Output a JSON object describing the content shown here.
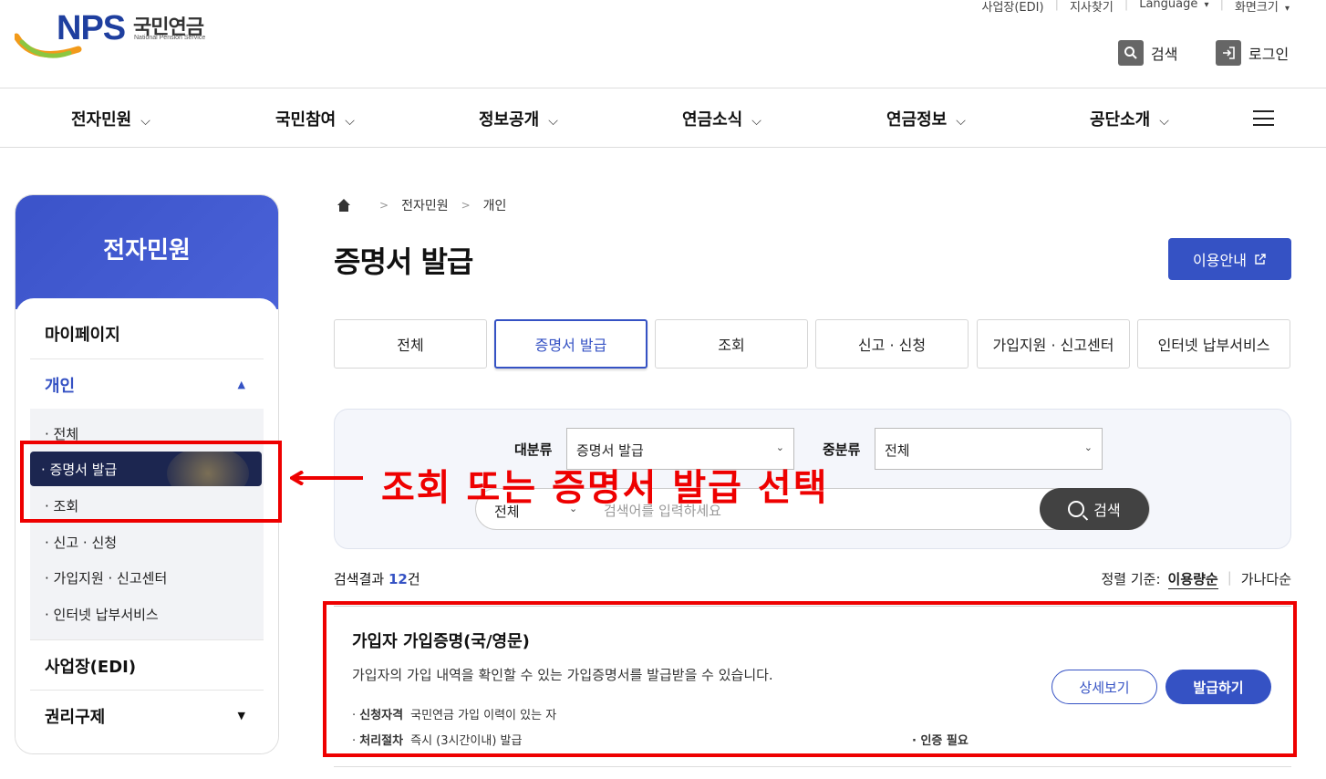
{
  "header": {
    "logo_brand": "NPS",
    "logo_korean": "국민연금",
    "logo_english": "National Pension Service",
    "util_links": [
      "사업장(EDI)",
      "지사찾기",
      "Language",
      "화면크기"
    ],
    "search_label": "검색",
    "login_label": "로그인"
  },
  "gnb": {
    "items": [
      "전자민원",
      "국민참여",
      "정보공개",
      "연금소식",
      "연금정보",
      "공단소개"
    ]
  },
  "sidebar": {
    "title": "전자민원",
    "sections": [
      {
        "label": "마이페이지"
      },
      {
        "label": "개인"
      },
      {
        "label": "사업장(EDI)"
      },
      {
        "label": "권리구제"
      }
    ],
    "sub_items": [
      "전체",
      "증명서 발급",
      "조회",
      "신고 · 신청",
      "가입지원 · 신고센터",
      "인터넷 납부서비스"
    ]
  },
  "breadcrumb": [
    "전자민원",
    "개인"
  ],
  "page": {
    "title": "증명서 발급",
    "guide_button": "이용안내"
  },
  "tabs": [
    "전체",
    "증명서 발급",
    "조회",
    "신고 · 신청",
    "가입지원 · 신고센터",
    "인터넷 납부서비스"
  ],
  "search": {
    "major_label": "대분류",
    "major_value": "증명서 발급",
    "minor_label": "중분류",
    "minor_value": "전체",
    "scope_value": "전체",
    "placeholder": "검색어를 입력하세요",
    "button_label": "검색"
  },
  "annotation": {
    "text": "조회 또는 증명서 발급 선택",
    "color": "#ee0000"
  },
  "results": {
    "count_prefix": "검색결과",
    "count": "12",
    "count_suffix": "건",
    "sort_label": "정렬 기준:",
    "sort_options": [
      "이용량순",
      "가나다순"
    ]
  },
  "card": {
    "title": "가입자 가입증명(국/영문)",
    "desc": "가입자의 가입 내역을 확인할 수 있는 가입증명서를 발급받을 수 있습니다.",
    "eligibility_label": "신청자격",
    "eligibility_value": "국민연금 가입 이력이 있는 자",
    "process_label": "처리절차",
    "process_value": "즉시 (3시간이내) 발급",
    "auth_note": "인증 필요",
    "detail_button": "상세보기",
    "issue_button": "발급하기"
  },
  "colors": {
    "primary": "#3552c4",
    "annotation": "#ee0000"
  }
}
